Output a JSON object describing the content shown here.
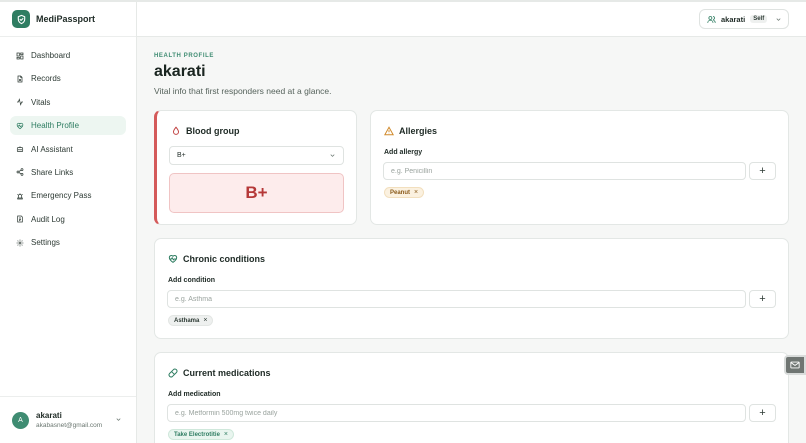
{
  "app": {
    "name": "MediPassport"
  },
  "sidebar": {
    "items": [
      {
        "label": "Dashboard",
        "icon": "dashboard-icon",
        "active": false
      },
      {
        "label": "Records",
        "icon": "file-icon",
        "active": false
      },
      {
        "label": "Vitals",
        "icon": "pulse-icon",
        "active": false
      },
      {
        "label": "Health Profile",
        "icon": "heart-pulse-icon",
        "active": true
      },
      {
        "label": "AI Assistant",
        "icon": "bot-icon",
        "active": false
      },
      {
        "label": "Share Links",
        "icon": "share-icon",
        "active": false
      },
      {
        "label": "Emergency Pass",
        "icon": "siren-icon",
        "active": false
      },
      {
        "label": "Audit Log",
        "icon": "log-icon",
        "active": false
      },
      {
        "label": "Settings",
        "icon": "gear-icon",
        "active": false
      }
    ],
    "user": {
      "initial": "A",
      "name": "akarati",
      "email": "akabasnet@gmail.com"
    }
  },
  "topbar": {
    "profile_name": "akarati",
    "profile_badge": "Self"
  },
  "page": {
    "eyebrow": "HEALTH PROFILE",
    "title": "akarati",
    "subtitle": "Vital info that first responders need at a glance."
  },
  "blood_group": {
    "title": "Blood group",
    "selected": "B+",
    "display": "B+"
  },
  "allergies": {
    "title": "Allergies",
    "field_label": "Add allergy",
    "placeholder": "e.g. Penicillin",
    "add_label": "+",
    "items": [
      "Peanut"
    ]
  },
  "chronic": {
    "title": "Chronic conditions",
    "field_label": "Add condition",
    "placeholder": "e.g. Asthma",
    "add_label": "+",
    "items": [
      "Asthama"
    ]
  },
  "medications": {
    "title": "Current medications",
    "field_label": "Add medication",
    "placeholder": "e.g. Metformin 500mg twice daily",
    "add_label": "+",
    "items": [
      "Take Electrotitie"
    ]
  },
  "chip_remove": "×",
  "colors": {
    "accent": "#2f7d62",
    "blood": "#b53838",
    "warning": "#d08a2c"
  }
}
